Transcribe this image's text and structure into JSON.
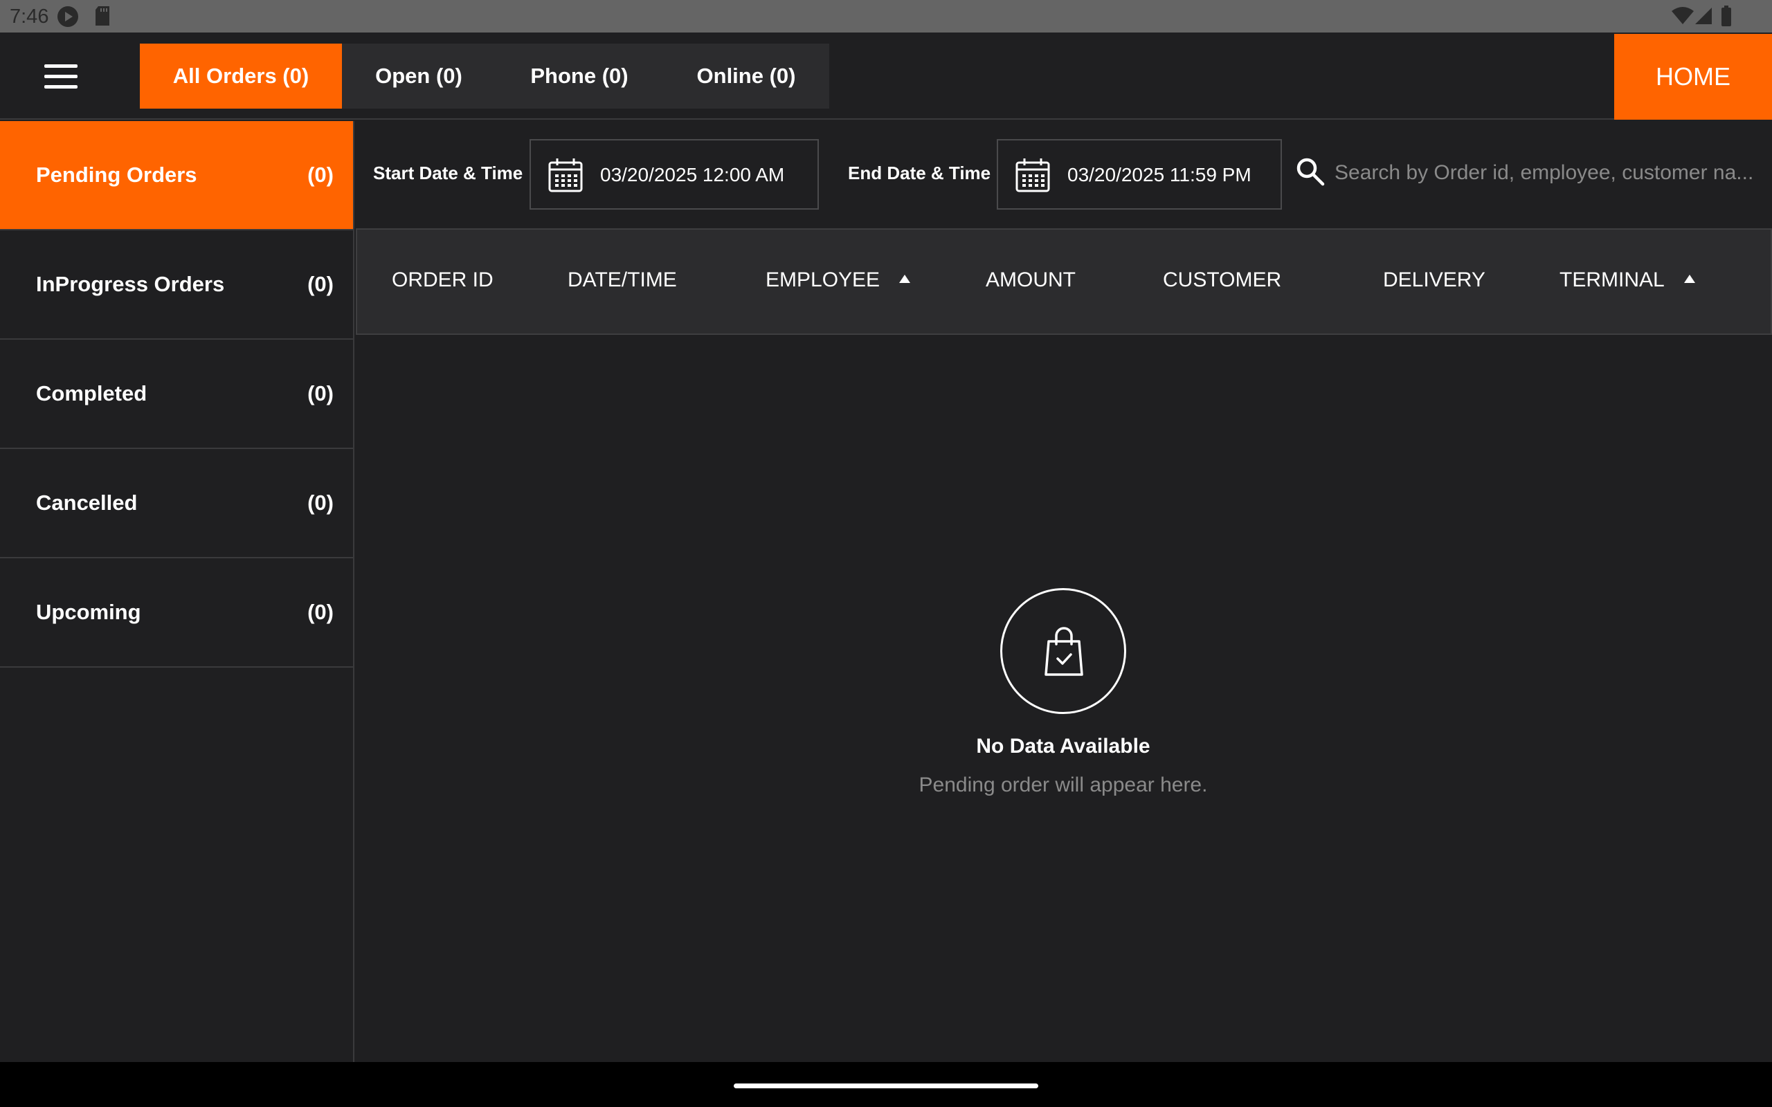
{
  "status_bar": {
    "time": "7:46"
  },
  "header": {
    "tabs": [
      {
        "label": "All Orders (0)"
      },
      {
        "label": "Open (0)"
      },
      {
        "label": "Phone (0)"
      },
      {
        "label": "Online (0)"
      }
    ],
    "active_tab": 0,
    "home_label": "HOME"
  },
  "sidebar": {
    "items": [
      {
        "label": "Pending Orders",
        "count": "(0)"
      },
      {
        "label": "InProgress Orders",
        "count": "(0)"
      },
      {
        "label": "Completed",
        "count": "(0)"
      },
      {
        "label": "Cancelled",
        "count": "(0)"
      },
      {
        "label": "Upcoming",
        "count": "(0)"
      }
    ],
    "active_index": 0
  },
  "filters": {
    "start_label": "Start Date & Time",
    "start_value": "03/20/2025 12:00 AM",
    "end_label": "End Date & Time",
    "end_value": "03/20/2025 11:59 PM",
    "search_placeholder": "Search by Order id, employee, customer na..."
  },
  "table": {
    "columns": [
      "ORDER ID",
      "DATE/TIME",
      "EMPLOYEE",
      "AMOUNT",
      "CUSTOMER",
      "DELIVERY",
      "TERMINAL"
    ],
    "sorted_columns": [
      "EMPLOYEE",
      "TERMINAL"
    ],
    "rows": []
  },
  "empty_state": {
    "title": "No Data Available",
    "subtitle": "Pending order will appear here."
  },
  "colors": {
    "accent": "#ff6400",
    "background": "#1f1f21",
    "panel": "#2c2c2e",
    "muted_text": "#8a8a8a"
  },
  "icons": {
    "menu": "hamburger-menu-icon",
    "calendar": "calendar-icon",
    "search": "search-icon",
    "empty": "shopping-bag-check-icon"
  }
}
